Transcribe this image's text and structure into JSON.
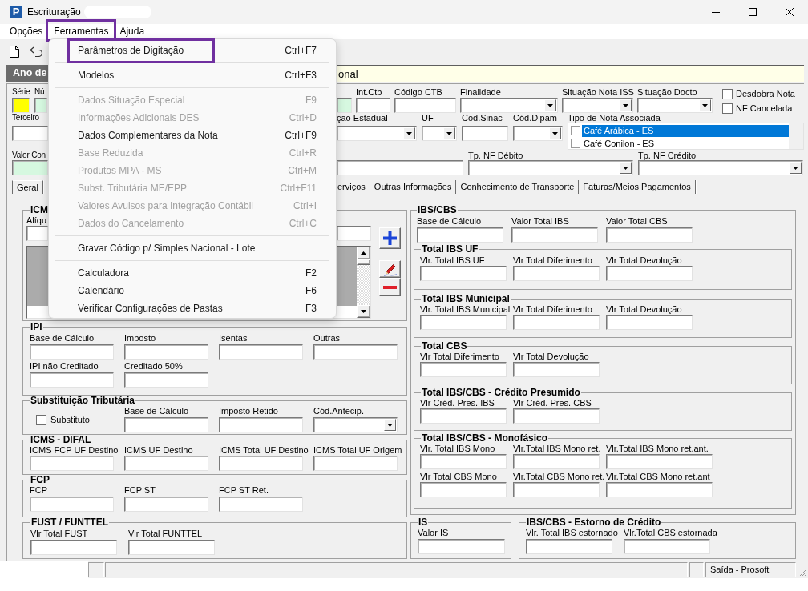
{
  "window": {
    "logo_text": "P",
    "title": "Escrituração"
  },
  "menu_bar": [
    {
      "label": "Opções",
      "highlighted": false
    },
    {
      "label": "Ferramentas",
      "highlighted": true
    },
    {
      "label": "Ajuda",
      "highlighted": false
    }
  ],
  "open_menu": {
    "items": [
      {
        "kind": "item",
        "label": "Parâmetros de Digitação",
        "shortcut": "Ctrl+F7",
        "disabled": false,
        "highlighted": true
      },
      {
        "kind": "separator"
      },
      {
        "kind": "item",
        "label": "Modelos",
        "shortcut": "Ctrl+F3",
        "disabled": false,
        "highlighted": false
      },
      {
        "kind": "separator"
      },
      {
        "kind": "item",
        "label": "Dados Situação Especial",
        "shortcut": "F9",
        "disabled": true,
        "highlighted": false
      },
      {
        "kind": "item",
        "label": "Informações Adicionais DES",
        "shortcut": "Ctrl+D",
        "disabled": true,
        "highlighted": false
      },
      {
        "kind": "item",
        "label": "Dados Complementares da Nota",
        "shortcut": "Ctrl+F9",
        "disabled": false,
        "highlighted": false
      },
      {
        "kind": "item",
        "label": "Base Reduzida",
        "shortcut": "Ctrl+R",
        "disabled": true,
        "highlighted": false
      },
      {
        "kind": "item",
        "label": "Produtos MPA - MS",
        "shortcut": "Ctrl+M",
        "disabled": true,
        "highlighted": false
      },
      {
        "kind": "item",
        "label": "Subst. Tributária ME/EPP",
        "shortcut": "Ctrl+F11",
        "disabled": true,
        "highlighted": false
      },
      {
        "kind": "item",
        "label": "Valores Avulsos para Integração Contábil",
        "shortcut": "Ctrl+I",
        "disabled": true,
        "highlighted": false
      },
      {
        "kind": "item",
        "label": "Dados do Cancelamento",
        "shortcut": "Ctrl+C",
        "disabled": true,
        "highlighted": false
      },
      {
        "kind": "separator"
      },
      {
        "kind": "item",
        "label": "Gravar Código p/ Simples Nacional - Lote",
        "disabled": false,
        "highlighted": false
      },
      {
        "kind": "separator"
      },
      {
        "kind": "item",
        "label": "Calculadora",
        "shortcut": "F2",
        "disabled": false,
        "highlighted": false
      },
      {
        "kind": "item",
        "label": "Calendário",
        "shortcut": "F6",
        "disabled": false,
        "highlighted": false
      },
      {
        "kind": "item",
        "label": "Verificar Configurações de Pastas",
        "shortcut": "F3",
        "disabled": false,
        "highlighted": false
      }
    ]
  },
  "header": {
    "label": "Ano de",
    "value": "onal"
  },
  "top_form": [
    {
      "left": [
        {
          "label": "Série",
          "kind": "text",
          "color": "#ffff00"
        },
        {
          "label": "Nú",
          "kind": "text",
          "color": "#d6f8e0"
        }
      ],
      "right": [
        {
          "kind": "text",
          "color": "#d6f8e0"
        },
        {
          "label": "Int.Ctb",
          "kind": "text"
        },
        {
          "label": "Código CTB",
          "kind": "text"
        },
        {
          "label": "Finalidade",
          "kind": "combo"
        },
        {
          "label": "Situação Nota ISS",
          "kind": "combo"
        },
        {
          "label": "Situação Docto",
          "kind": "combo"
        },
        {
          "kind": "checks",
          "items": [
            {
              "label": "Desdobra Nota",
              "checked": false
            },
            {
              "label": "NF Cancelada",
              "checked": false
            }
          ]
        }
      ]
    },
    {
      "left": [
        {
          "label": "Terceiro",
          "kind": "text"
        }
      ],
      "right": [
        {
          "label": "ção Estadual",
          "kind": "combo"
        },
        {
          "label": "UF",
          "kind": "combo"
        },
        {
          "label": "Cod.Sinac",
          "kind": "text"
        },
        {
          "label": "Cód.Dipam",
          "kind": "combo"
        },
        {
          "label": "Tipo de Nota Associada",
          "kind": "checklist",
          "options": [
            {
              "label": "Café Arábica - ES",
              "checked": false,
              "selected": true
            },
            {
              "label": "Café Conilon - ES",
              "checked": false,
              "selected": false
            }
          ]
        }
      ]
    },
    {
      "left": [
        {
          "label": "Valor Con",
          "kind": "text",
          "color": "#d6f8e0"
        }
      ],
      "right": [
        {
          "kind": "text"
        },
        {
          "label": "Tp. NF Débito",
          "kind": "combo"
        },
        {
          "label": "Tp. NF Crédito",
          "kind": "combo"
        }
      ]
    }
  ],
  "tabs": [
    {
      "label": "Geral",
      "selected": true
    },
    {
      "label": "erviços",
      "selected": false
    },
    {
      "label": "Outras Informações",
      "selected": false
    },
    {
      "label": "Conhecimento de Transporte",
      "selected": false
    },
    {
      "label": "Faturas/Meios Pagamentos",
      "selected": false
    }
  ],
  "icms": {
    "title": "ICM",
    "fields": [
      {
        "label": "Alíqu",
        "kind": "text"
      },
      {
        "kind": "text"
      }
    ]
  },
  "left_groups": [
    {
      "title": "IPI",
      "rows": [
        [
          {
            "label": "Base de Cálculo",
            "kind": "text"
          },
          {
            "label": "Imposto",
            "kind": "text"
          },
          {
            "label": "Isentas",
            "kind": "text"
          },
          {
            "label": "Outras",
            "kind": "text"
          }
        ],
        [
          {
            "label": "IPI não Creditado",
            "kind": "text"
          },
          {
            "label": "Creditado 50%",
            "kind": "text"
          }
        ]
      ]
    },
    {
      "title": "Substituição Tributária",
      "rows": [
        [
          {
            "label": "Substituto",
            "kind": "checkbox",
            "checked": false
          },
          {
            "label": "Base de Cálculo",
            "kind": "text"
          },
          {
            "label": "Imposto Retido",
            "kind": "text"
          },
          {
            "label": "Cód.Antecip.",
            "kind": "combo"
          }
        ]
      ]
    },
    {
      "title": "ICMS - DIFAL",
      "rows": [
        [
          {
            "label": "ICMS FCP UF Destino",
            "kind": "text"
          },
          {
            "label": "ICMS UF Destino",
            "kind": "text"
          },
          {
            "label": "ICMS Total UF Destino",
            "kind": "text"
          },
          {
            "label": "ICMS Total UF Origem",
            "kind": "text"
          }
        ]
      ]
    },
    {
      "title": "FCP",
      "rows": [
        [
          {
            "label": "FCP",
            "kind": "text"
          },
          {
            "label": "FCP ST",
            "kind": "text"
          },
          {
            "label": "FCP ST Ret.",
            "kind": "text"
          }
        ]
      ]
    },
    {
      "title": "FUST / FUNTTEL",
      "rows": [
        [
          {
            "label": "Vlr Total FUST",
            "kind": "text"
          },
          {
            "label": "Vlr Total FUNTTEL",
            "kind": "text"
          }
        ]
      ]
    }
  ],
  "ibs_cbs": {
    "title": "IBS/CBS",
    "rows": [
      [
        {
          "label": "Base de Cálculo",
          "kind": "text"
        },
        {
          "label": "Valor Total IBS",
          "kind": "text"
        },
        {
          "label": "Valor Total CBS",
          "kind": "text"
        }
      ]
    ],
    "subgroups": [
      {
        "title": "Total IBS UF",
        "rows": [
          [
            {
              "label": "Vlr. Total IBS UF",
              "kind": "text"
            },
            {
              "label": "Vlr Total Diferimento",
              "kind": "text"
            },
            {
              "label": "Vlr Total Devolução",
              "kind": "text"
            }
          ]
        ]
      },
      {
        "title": "Total IBS Municipal",
        "rows": [
          [
            {
              "label": "Vlr. Total IBS Municipal",
              "kind": "text"
            },
            {
              "label": "Vlr Total Diferimento",
              "kind": "text"
            },
            {
              "label": "Vlr Total Devolução",
              "kind": "text"
            }
          ]
        ]
      },
      {
        "title": "Total CBS",
        "rows": [
          [
            {
              "label": "Vlr Total Diferimento",
              "kind": "text"
            },
            {
              "label": "Vlr Total Devolução",
              "kind": "text"
            }
          ]
        ]
      },
      {
        "title": "Total IBS/CBS - Crédito Presumido",
        "rows": [
          [
            {
              "label": "Vlr Créd. Pres. IBS",
              "kind": "text"
            },
            {
              "label": "Vlr Créd. Pres. CBS",
              "kind": "text"
            }
          ]
        ]
      },
      {
        "title": "Total IBS/CBS - Monofásico",
        "rows": [
          [
            {
              "label": "Vlr. Total IBS Mono",
              "kind": "text"
            },
            {
              "label": "Vlr.Total IBS Mono ret.",
              "kind": "text"
            },
            {
              "label": "Vlr.Total IBS Mono ret.ant.",
              "kind": "text"
            }
          ],
          [
            {
              "label": "Vlr Total CBS Mono",
              "kind": "text"
            },
            {
              "label": "Vlr.Total CBS Mono ret.",
              "kind": "text"
            },
            {
              "label": "Vlr.Total CBS Mono ret.ant",
              "kind": "text"
            }
          ]
        ]
      }
    ]
  },
  "bottom_right_groups": [
    {
      "title": "IS",
      "rows": [
        [
          {
            "label": "Valor IS",
            "kind": "text"
          }
        ]
      ]
    },
    {
      "title": "IBS/CBS - Estorno de Crédito",
      "rows": [
        [
          {
            "label": "Vlr. Total IBS estornado",
            "kind": "text"
          },
          {
            "label": "Vlr.Total CBS estornada",
            "kind": "text"
          }
        ]
      ]
    }
  ],
  "status_bar": {
    "text": "Saída - Prosoft"
  }
}
